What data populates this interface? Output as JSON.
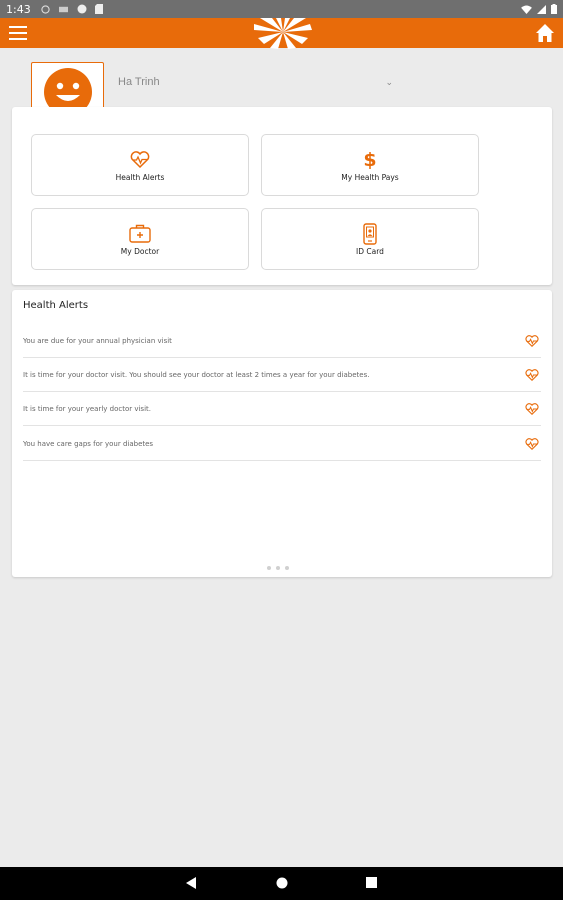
{
  "status_bar": {
    "time": "1:43"
  },
  "app_bar": {
    "color": "#e86b0a",
    "menu_icon": "hamburger-icon",
    "home_icon": "home-icon",
    "logo_icon": "starburst-logo"
  },
  "user": {
    "name": "Ha Trinh",
    "avatar_icon": "smiley-avatar-icon",
    "dropdown_icon": "chevron-down-icon",
    "chevron": "⌄"
  },
  "tiles": [
    {
      "label": "Health Alerts",
      "icon": "heart-pulse-icon"
    },
    {
      "label": "My Health Pays",
      "icon": "dollar-icon",
      "symbol": "$"
    },
    {
      "label": "My Doctor",
      "icon": "medical-bag-icon"
    },
    {
      "label": "ID Card",
      "icon": "phone-card-icon"
    }
  ],
  "alerts": {
    "title": "Health Alerts",
    "items": [
      {
        "text": "You are due for your annual physician visit"
      },
      {
        "text": "It is time for your doctor visit.  You should see your doctor at least 2 times a year for your diabetes."
      },
      {
        "text": "It is time for your yearly doctor visit."
      },
      {
        "text": "You have care gaps for your diabetes"
      }
    ],
    "pager_pages": 3
  }
}
